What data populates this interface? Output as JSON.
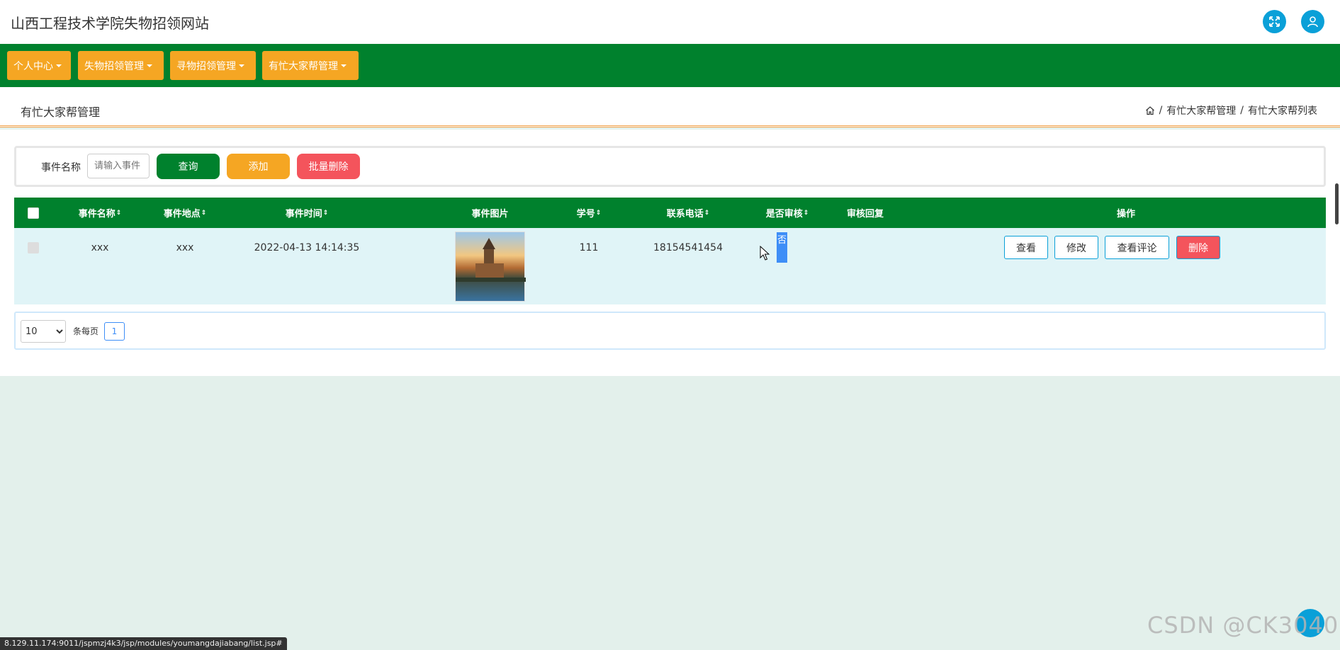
{
  "header": {
    "site_title": "山西工程技术学院失物招领网站",
    "icons": [
      "expand-icon",
      "user-icon"
    ]
  },
  "nav": {
    "items": [
      {
        "label": "个人中心"
      },
      {
        "label": "失物招领管理"
      },
      {
        "label": "寻物招领管理"
      },
      {
        "label": "有忙大家帮管理"
      }
    ]
  },
  "page": {
    "heading": "有忙大家帮管理",
    "breadcrumb": [
      "有忙大家帮管理",
      "有忙大家帮列表"
    ]
  },
  "search": {
    "label": "事件名称",
    "placeholder": "请输入事件",
    "query_label": "查询",
    "add_label": "添加",
    "batch_delete_label": "批量删除"
  },
  "table": {
    "columns": [
      "事件名称",
      "事件地点",
      "事件时间",
      "事件图片",
      "学号",
      "联系电话",
      "是否审核",
      "审核回复",
      "操作"
    ],
    "sort_glyph": "⇕",
    "rows": [
      {
        "name": "xxx",
        "location": "xxx",
        "time": "2022-04-13 14:14:35",
        "image": "photo-thumbnail",
        "student_id": "111",
        "phone": "18154541454",
        "reviewed": "否",
        "reply": "",
        "actions": [
          "查看",
          "修改",
          "查看评论",
          "删除"
        ]
      }
    ]
  },
  "pagination": {
    "page_size": "10",
    "per_page_label": "条每页",
    "current_page": "1"
  },
  "status_bar": {
    "url": "8.129.11.174:9011/jspmzj4k3/jsp/modules/youmangdajiabang/list.jsp#"
  },
  "watermark": "CSDN @CK3040",
  "colors": {
    "primary_green": "#00812d",
    "orange": "#f5a623",
    "red": "#f4545c",
    "blue": "#0aa0d8",
    "row_bg": "#e0f4f7"
  }
}
